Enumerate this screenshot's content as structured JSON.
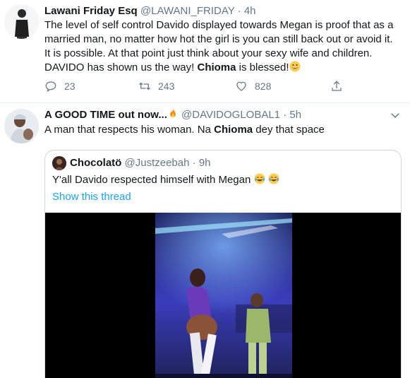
{
  "tweet1": {
    "display_name": "Lawani Friday Esq",
    "handle": "@LAWANI_FRIDAY",
    "separator": "·",
    "time": "4h",
    "text_line1": "The level of self control Davido displayed towards Megan is proof that as a",
    "text_line2": "married man, no matter how hot the girl is you can still back out or avoid it.",
    "text_line3": "It is possible. At that point just think about your sexy wife and children.",
    "text_line4_a": "DAVIDO has shown us the way! ",
    "text_line4_b": "Chioma",
    "text_line4_c": " is blessed!",
    "replies": "23",
    "retweets": "243",
    "likes": "828"
  },
  "tweet2": {
    "display_name": "A GOOD TIME out now...",
    "handle": "@DAVIDOGLOBAL1",
    "separator": "·",
    "time": "5h",
    "text_a": "A man that respects his woman. Na ",
    "text_b": "Chioma",
    "text_c": " dey that space",
    "quote": {
      "display_name": "Chocolatö",
      "handle": "@Justzeebah",
      "separator": "·",
      "time": "9h",
      "text": "Y'all Davido respected himself with Megan ",
      "show_thread": "Show this thread"
    }
  },
  "icons": {
    "reply": "reply-icon",
    "retweet": "retweet-icon",
    "like": "heart-icon",
    "share": "share-icon",
    "caret": "chevron-down-icon",
    "fire": "fire-emoji",
    "grin": "grinning-emoji",
    "laugh": "tears-of-joy-emoji"
  },
  "colors": {
    "link": "#1da1f2",
    "secondary_text": "#657786",
    "divider": "#e6ecf0"
  }
}
